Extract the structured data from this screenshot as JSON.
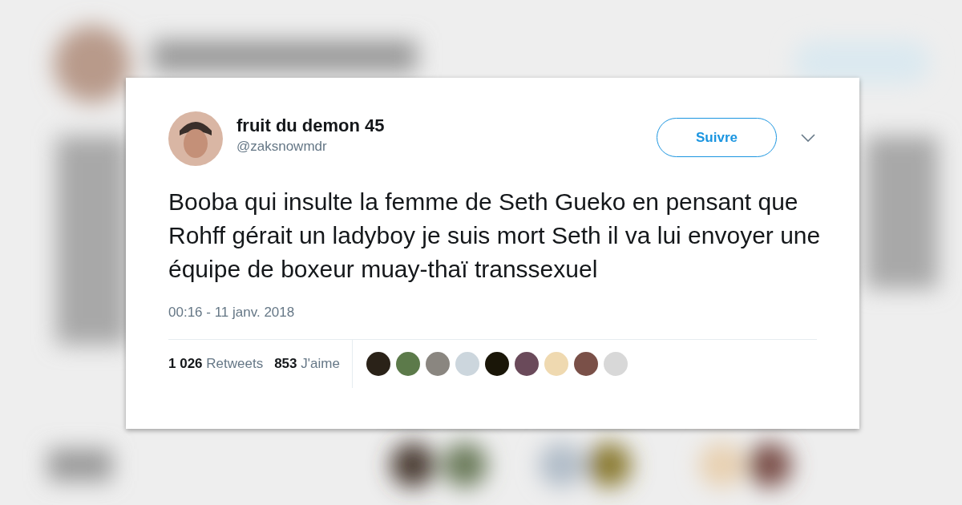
{
  "tweet": {
    "author": {
      "name": "fruit du demon 45",
      "handle": "@zaksnowmdr"
    },
    "follow_button": "Suivre",
    "text": "Booba qui insulte la femme de Seth Gueko en pensant que Rohff gérait un ladyboy je suis mort Seth il va lui envoyer une équipe de boxeur muay-thaï transsexuel",
    "timestamp": "00:16 - 11 janv. 2018",
    "retweets": {
      "count": "1 026",
      "label": "Retweets"
    },
    "likes": {
      "count": "853",
      "label": "J'aime"
    },
    "likers": [
      {
        "color": "#2a2218"
      },
      {
        "color": "#5c7a4a"
      },
      {
        "color": "#8a8680"
      },
      {
        "color": "#ccd6dd"
      },
      {
        "color": "#1a1608"
      },
      {
        "color": "#6a4a5a"
      },
      {
        "color": "#efd9b0"
      },
      {
        "color": "#7a5048"
      },
      {
        "color": "#d8d8d8"
      }
    ]
  }
}
